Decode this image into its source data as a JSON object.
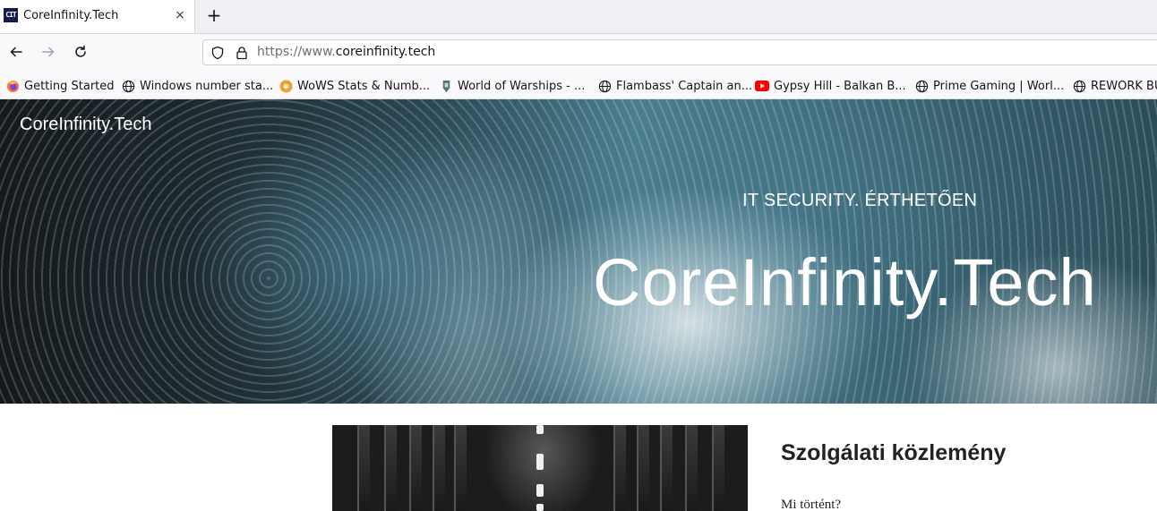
{
  "browser": {
    "tab": {
      "favicon_text": "CIT",
      "title": "CoreInfinity.Tech",
      "close_glyph": "×"
    },
    "new_tab_glyph": "+",
    "url": {
      "scheme_prefix": "https://www.",
      "host": "coreinfinity.tech"
    },
    "bookmarks": [
      {
        "label": "Getting Started",
        "icon": "firefox-icon"
      },
      {
        "label": "Windows number sta...",
        "icon": "globe-icon"
      },
      {
        "label": "WoWS Stats & Numb...",
        "icon": "wows-stats-icon"
      },
      {
        "label": "World of Warships - ...",
        "icon": "warships-icon"
      },
      {
        "label": "Flambass' Captain an...",
        "icon": "globe-icon"
      },
      {
        "label": "Gypsy Hill - Balkan B...",
        "icon": "youtube-icon"
      },
      {
        "label": "Prime Gaming | Worl...",
        "icon": "globe-icon"
      },
      {
        "label": "REWORK BU",
        "icon": "globe-icon"
      }
    ]
  },
  "site": {
    "brand": "CoreInfinity.Tech",
    "hero_subtitle": "IT SECURITY. ÉRTHETŐEN",
    "hero_title": "CoreInfinity.Tech"
  },
  "post": {
    "title": "Szolgálati közlemény",
    "first_heading": "Mi történt?"
  },
  "colors": {
    "tab_strip": "#f0f0f4",
    "hero_accent": "#4c7f90",
    "text_dark": "#222222"
  }
}
